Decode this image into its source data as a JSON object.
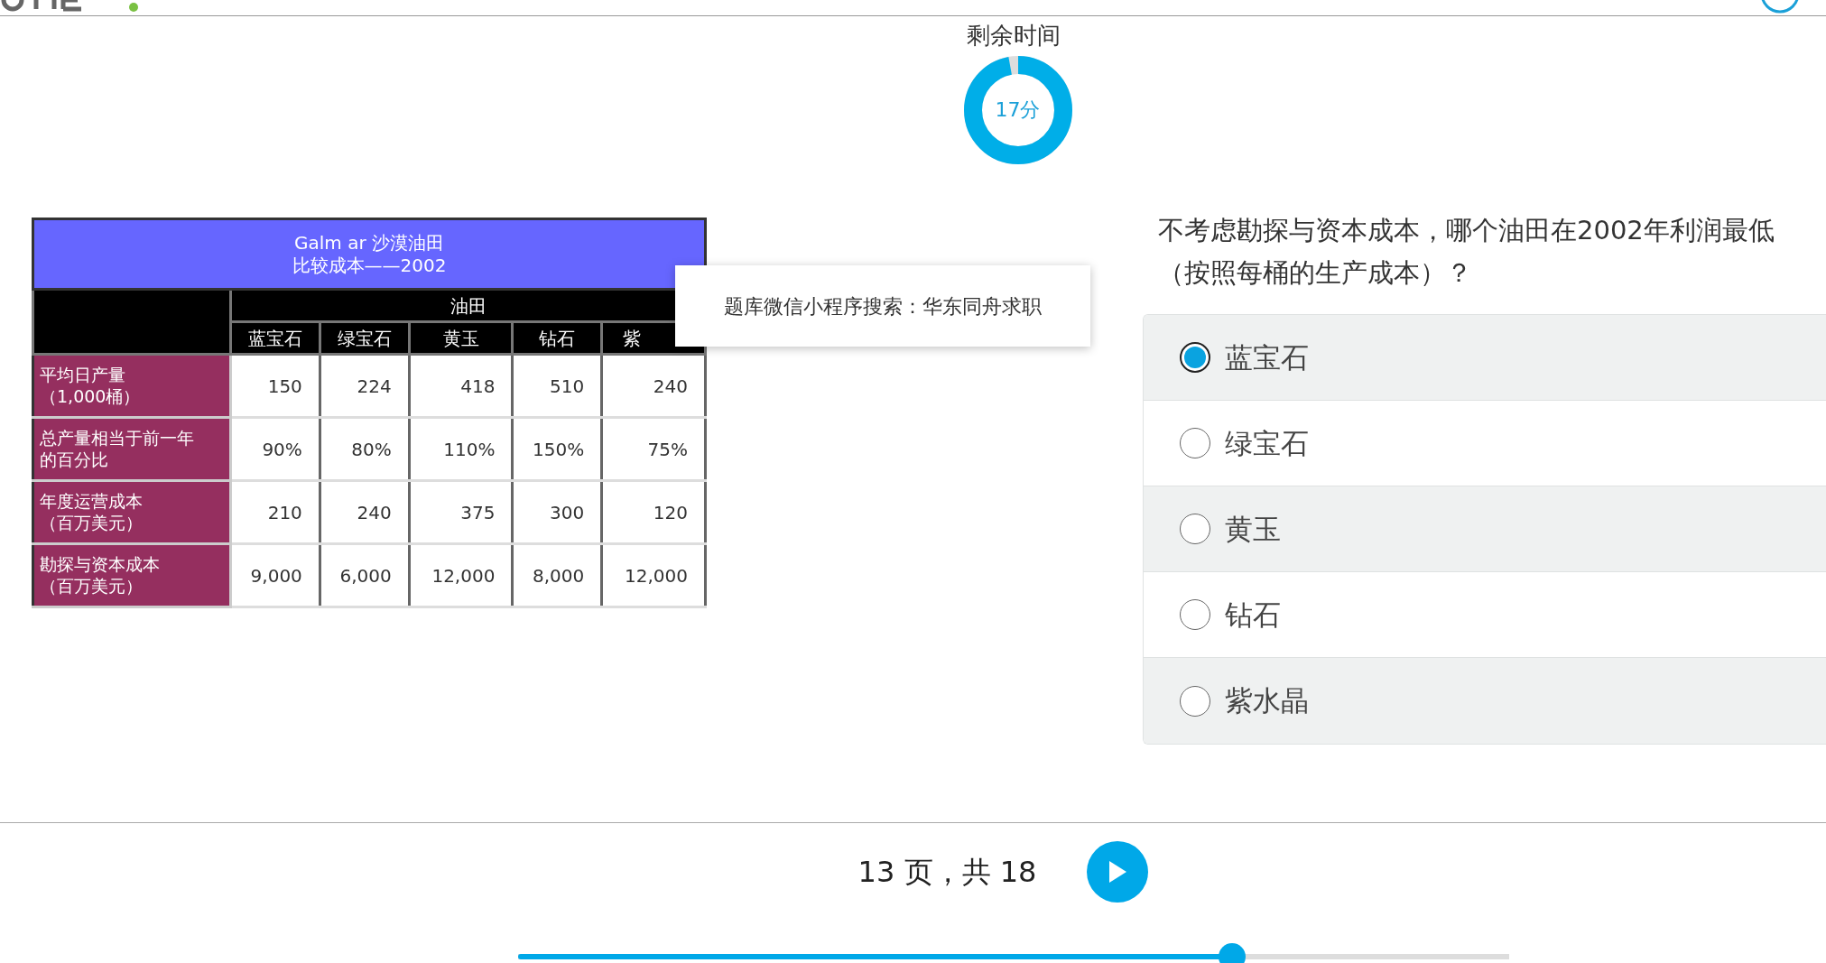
{
  "timer": {
    "label": "剩余时间",
    "value": "17分",
    "level": 0.97
  },
  "table": {
    "title_lines": [
      "Galm ar  沙漠油田",
      "比较成本——2002"
    ],
    "group_header": "油田",
    "columns": [
      "蓝宝石",
      "绿宝石",
      "黄玉",
      "钻石",
      "紫"
    ],
    "rows": [
      {
        "label_lines": [
          "平均日产量",
          "（1,000桶）"
        ],
        "cells": [
          "150",
          "224",
          "418",
          "510",
          "240"
        ]
      },
      {
        "label_lines": [
          "总产量相当于前一年",
          "的百分比"
        ],
        "cells": [
          "90%",
          "80%",
          "110%",
          "150%",
          "75%"
        ]
      },
      {
        "label_lines": [
          "年度运营成本",
          "（百万美元）"
        ],
        "cells": [
          "210",
          "240",
          "375",
          "300",
          "120"
        ]
      },
      {
        "label_lines": [
          "勘探与资本成本",
          "（百万美元）"
        ],
        "cells": [
          "9,000",
          "6,000",
          "12,000",
          "8,000",
          "12,000"
        ]
      }
    ]
  },
  "popup": {
    "text": "题库微信小程序搜索：华东同舟求职"
  },
  "question": {
    "lines": [
      "不考虑勘探与资本成本，哪个油田在2002年利润最低",
      "（按照每桶的生产成本）？"
    ]
  },
  "options": [
    {
      "label": "蓝宝石",
      "selected": true
    },
    {
      "label": "绿宝石",
      "selected": false
    },
    {
      "label": "黄玉",
      "selected": false
    },
    {
      "label": "钻石",
      "selected": false
    },
    {
      "label": "紫水晶",
      "selected": false
    }
  ],
  "pager": {
    "text": "13 页，共 18",
    "level": 0.72
  }
}
